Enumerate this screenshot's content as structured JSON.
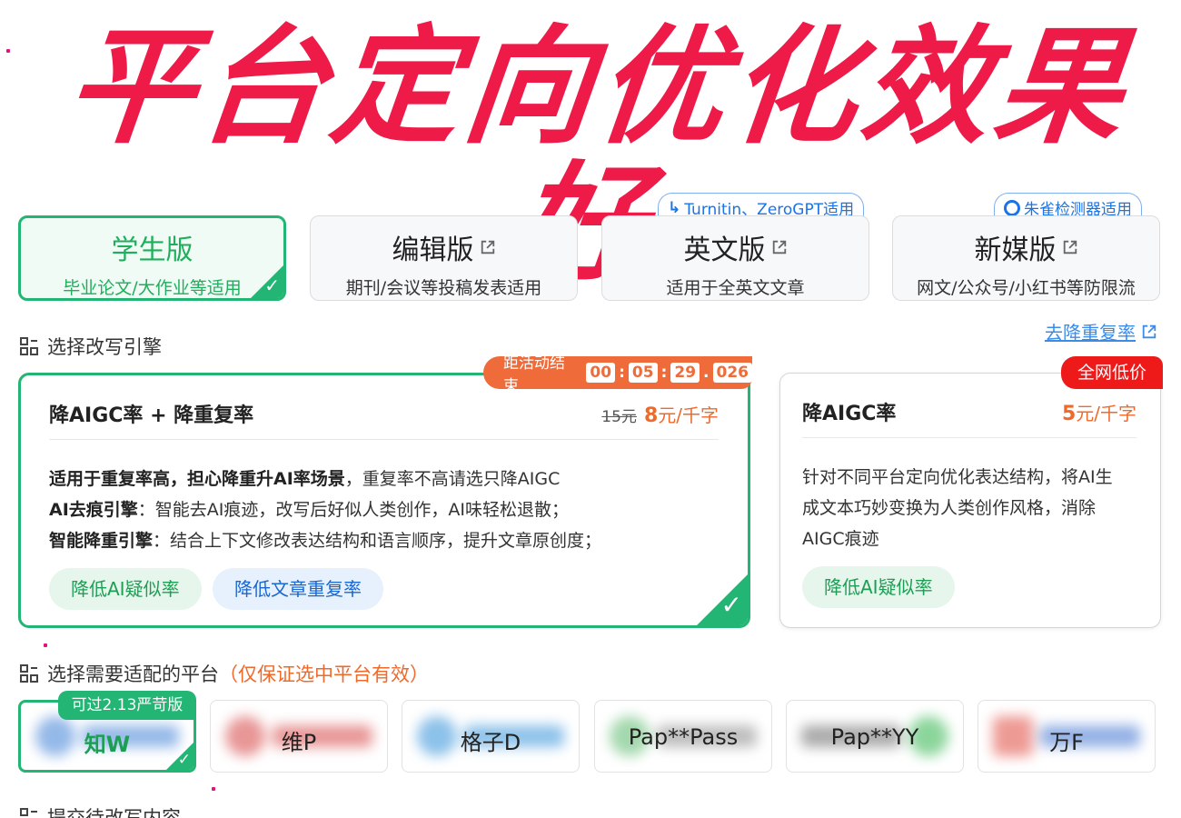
{
  "hero": {
    "title": "平台定向优化效果好"
  },
  "editions": [
    {
      "title": "学生版",
      "subtitle": "毕业论文/大作业等适用",
      "active": true,
      "external": false
    },
    {
      "title": "编辑版",
      "subtitle": "期刊/会议等投稿发表适用",
      "active": false,
      "external": true
    },
    {
      "title": "英文版",
      "subtitle": "适用于全英文文章",
      "active": false,
      "external": true,
      "badge": "Turnitin、ZeroGPT适用"
    },
    {
      "title": "新媒版",
      "subtitle": "网文/公众号/小红书等防限流",
      "active": false,
      "external": true,
      "badge": "朱雀检测器适用"
    }
  ],
  "engine_section": {
    "label": "选择改写引擎",
    "link": "去降重复率"
  },
  "engines": [
    {
      "title": "降AIGC率 + 降重复率",
      "old_price": "15元",
      "price_num": "8",
      "price_unit": "元/千字",
      "timer_label": "距活动结束",
      "timer": [
        "00",
        "05",
        "29",
        "026"
      ],
      "lines": [
        {
          "bold": "适用于重复率高，担心降重升AI率场景",
          "text": "，重复率不高请选只降AIGC"
        },
        {
          "bold": "AI去痕引擎",
          "text": "：智能去AI痕迹，改写后好似人类创作，AI味轻松退散；"
        },
        {
          "bold": "智能降重引擎",
          "text": "：结合上下文修改表达结构和语言顺序，提升文章原创度；"
        }
      ],
      "tags": [
        "降低AI疑似率",
        "降低文章重复率"
      ],
      "selected": true
    },
    {
      "title": "降AIGC率",
      "price_num": "5",
      "price_unit": "元/千字",
      "badge": "全网低价",
      "lines": [
        "针对不同平台定向优化表达结构，将AI生",
        "成文本巧妙变换为人类创作风格，消除",
        "AIGC痕迹"
      ],
      "tags": [
        "降低AI疑似率"
      ],
      "selected": false
    }
  ],
  "platform_section": {
    "label": "选择需要适配的平台",
    "note": "（仅保证选中平台有效）"
  },
  "platforms": [
    {
      "name": "知W",
      "active": true,
      "badge": "可过2.13严苛版",
      "color": "#3d7fd6"
    },
    {
      "name": "维P",
      "active": false,
      "color": "#d64040"
    },
    {
      "name": "格子D",
      "active": false,
      "color": "#2f8fd8"
    },
    {
      "name": "Pap**Pass",
      "active": false,
      "color": "#58b86a"
    },
    {
      "name": "Pap**YY",
      "active": false,
      "color": "#2db34a"
    },
    {
      "name": "万F",
      "active": false,
      "color": "#e0473c"
    }
  ],
  "bottom_section": {
    "label": "提交待改写内容"
  }
}
